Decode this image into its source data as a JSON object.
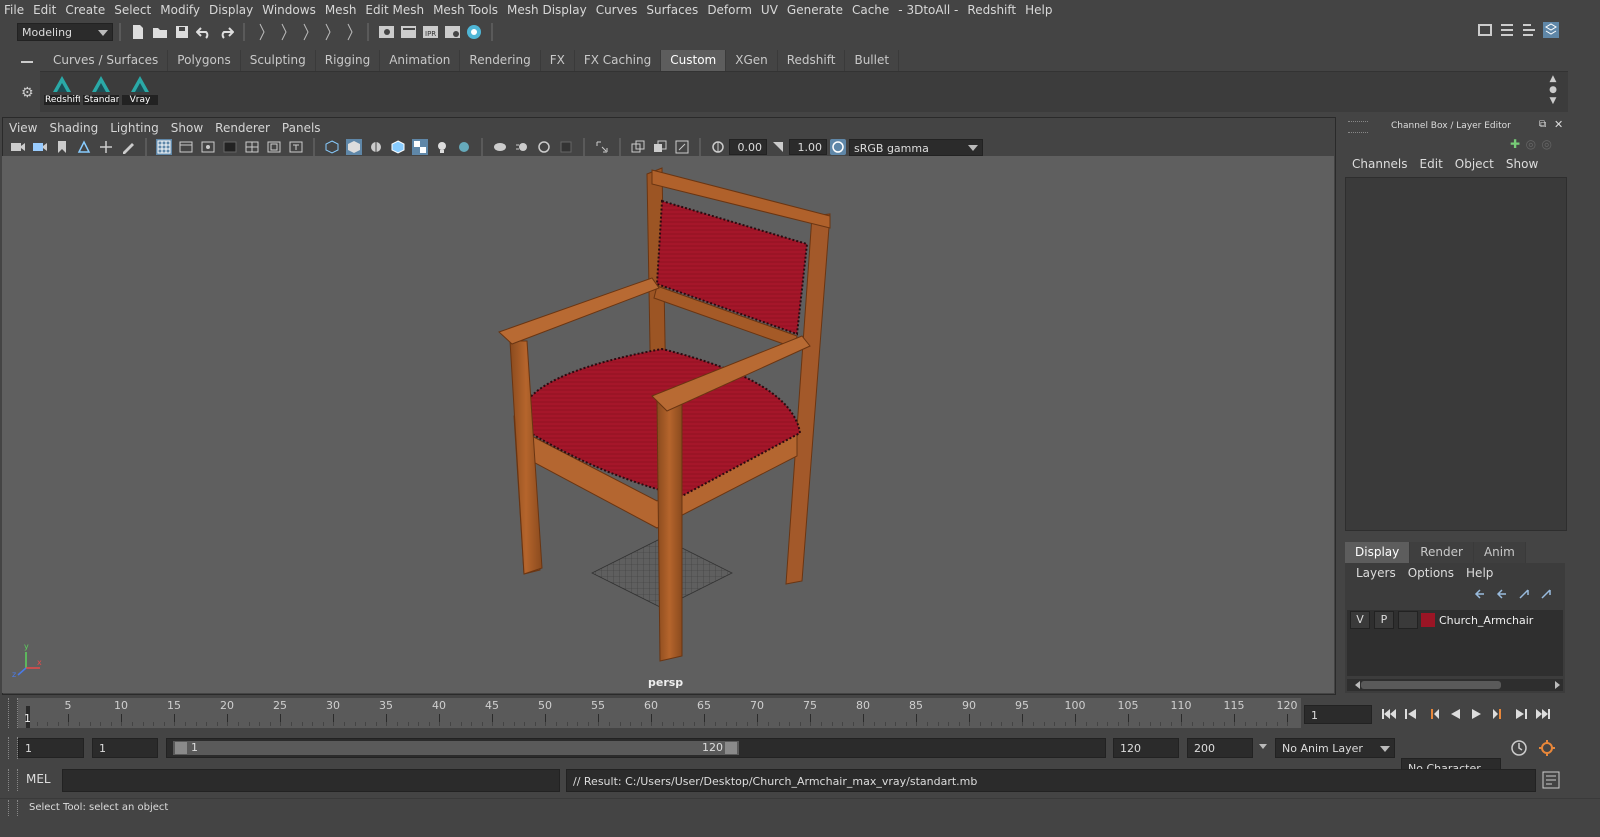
{
  "menu": [
    "File",
    "Edit",
    "Create",
    "Select",
    "Modify",
    "Display",
    "Windows",
    "Mesh",
    "Edit Mesh",
    "Mesh Tools",
    "Mesh Display",
    "Curves",
    "Surfaces",
    "Deform",
    "UV",
    "Generate",
    "Cache",
    "- 3DtoAll -",
    "Redshift",
    "Help"
  ],
  "status": {
    "mode": "Modeling"
  },
  "shelf": {
    "tabs": [
      "Curves / Surfaces",
      "Polygons",
      "Sculpting",
      "Rigging",
      "Animation",
      "Rendering",
      "FX",
      "FX Caching",
      "Custom",
      "XGen",
      "Redshift",
      "Bullet"
    ],
    "active_tab": "Custom",
    "icons": [
      {
        "label": "Redshift"
      },
      {
        "label": "Standard"
      },
      {
        "label": "Vray"
      }
    ]
  },
  "viewport": {
    "menu": [
      "View",
      "Shading",
      "Lighting",
      "Show",
      "Renderer",
      "Panels"
    ],
    "exposure": "0.00",
    "gamma": "1.00",
    "color_space": "sRGB gamma",
    "camera_label": "persp",
    "axis": {
      "x": "x",
      "y": "y",
      "z": "z"
    }
  },
  "channel_box": {
    "title": "Channel Box / Layer Editor",
    "menu": [
      "Channels",
      "Edit",
      "Object",
      "Show"
    ],
    "layer_tabs": [
      "Display",
      "Render",
      "Anim"
    ],
    "active_layer_tab": "Display",
    "layer_menu": [
      "Layers",
      "Options",
      "Help"
    ],
    "layers": [
      {
        "v": "V",
        "p": "P",
        "color": "#9a1525",
        "name": "Church_Armchair"
      }
    ]
  },
  "timeline": {
    "ticks": [
      "5",
      "10",
      "15",
      "20",
      "25",
      "30",
      "35",
      "40",
      "45",
      "50",
      "55",
      "60",
      "65",
      "70",
      "75",
      "80",
      "85",
      "90",
      "95",
      "100",
      "105",
      "110",
      "115",
      "120"
    ],
    "current_frame_label": "1",
    "current_frame": "1"
  },
  "range": {
    "start": "1",
    "playback_start": "1",
    "slider_start": "1",
    "slider_end": "120",
    "playback_end": "120",
    "end": "200",
    "anim_layer": "No Anim Layer",
    "character_set": "No Character Set"
  },
  "command": {
    "lang": "MEL",
    "input": "",
    "result": "// Result: C:/Users/User/Desktop/Church_Armchair_max_vray/standart.mb"
  },
  "help_line": "Select Tool: select an object"
}
